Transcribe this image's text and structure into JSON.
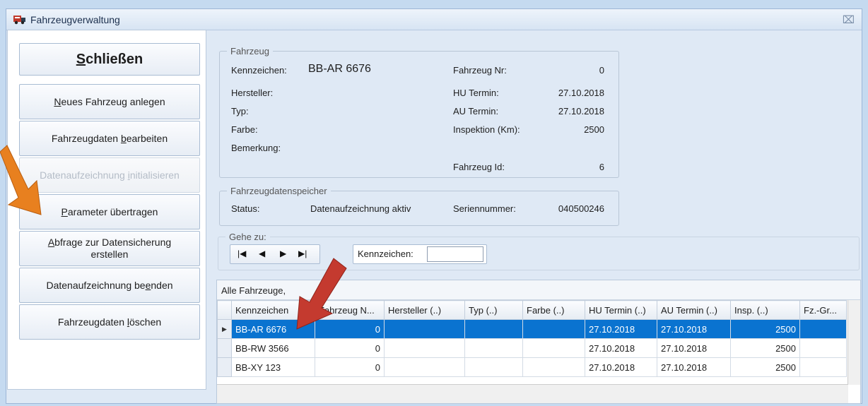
{
  "window": {
    "title": "Fahrzeugverwaltung",
    "close_glyph": "⌧"
  },
  "buttons": {
    "close": {
      "first": "S",
      "rest": "chließen"
    },
    "new": {
      "pre": "",
      "ul": "N",
      "post": "eues Fahrzeug anlegen"
    },
    "edit": {
      "pre": "Fahrzeugdaten ",
      "ul": "b",
      "post": "earbeiten"
    },
    "init": {
      "pre": "Datenaufzeichnung ",
      "ul": "i",
      "post": "nitialisieren"
    },
    "transfer": {
      "pre": "",
      "ul": "P",
      "post": "arameter übertragen"
    },
    "query_line1_ul": "A",
    "query_line1_rest": "bfrage zur Datensicherung",
    "query_line2": "erstellen",
    "end": {
      "pre": "Datenaufzeichnung be",
      "ul": "e",
      "post": "nden"
    },
    "delete": {
      "pre": "Fahrzeugdaten ",
      "ul": "l",
      "post": "öschen"
    }
  },
  "vehicle": {
    "group_label": "Fahrzeug",
    "kennzeichen_label": "Kennzeichen:",
    "kennzeichen_value": "BB-AR 6676",
    "nr_label": "Fahrzeug Nr:",
    "nr_value": "0",
    "hersteller_label": "Hersteller:",
    "typ_label": "Typ:",
    "farbe_label": "Farbe:",
    "bemerkung_label": "Bemerkung:",
    "hu_label": "HU Termin:",
    "hu_value": "27.10.2018",
    "au_label": "AU Termin:",
    "au_value": "27.10.2018",
    "insp_label": "Inspektion (Km):",
    "insp_value": "2500",
    "id_label": "Fahrzeug Id:",
    "id_value": "6"
  },
  "storage": {
    "group_label": "Fahrzeugdatenspeicher",
    "status_label": "Status:",
    "status_value": "Datenaufzeichnung aktiv",
    "serial_label": "Seriennummer:",
    "serial_value": "040500246"
  },
  "goto": {
    "group_label": "Gehe zu:",
    "first": "|◀",
    "prev": "◀",
    "next": "▶",
    "last": "▶|",
    "field_label": "Kennzeichen:",
    "field_value": ""
  },
  "grid": {
    "title": "Alle Fahrzeuge,",
    "columns": [
      "Kennzeichen",
      "Fahrzeug N...",
      "Hersteller (..)",
      "Typ (..)",
      "Farbe (..)",
      "HU Termin (..)",
      "AU Termin (..)",
      "Insp. (..)",
      "Fz.-Gr..."
    ],
    "rows": [
      [
        "BB-AR 6676",
        "0",
        "",
        "",
        "",
        "27.10.2018",
        "27.10.2018",
        "2500",
        ""
      ],
      [
        "BB-RW 3566",
        "0",
        "",
        "",
        "",
        "27.10.2018",
        "27.10.2018",
        "2500",
        ""
      ],
      [
        "BB-XY 123",
        "0",
        "",
        "",
        "",
        "27.10.2018",
        "27.10.2018",
        "2500",
        ""
      ]
    ],
    "selected_row": 0,
    "row_indicator": "▶"
  },
  "colors": {
    "selection": "#0a73d0",
    "arrow_orange": "#e8801f",
    "arrow_red": "#c43a2f"
  }
}
